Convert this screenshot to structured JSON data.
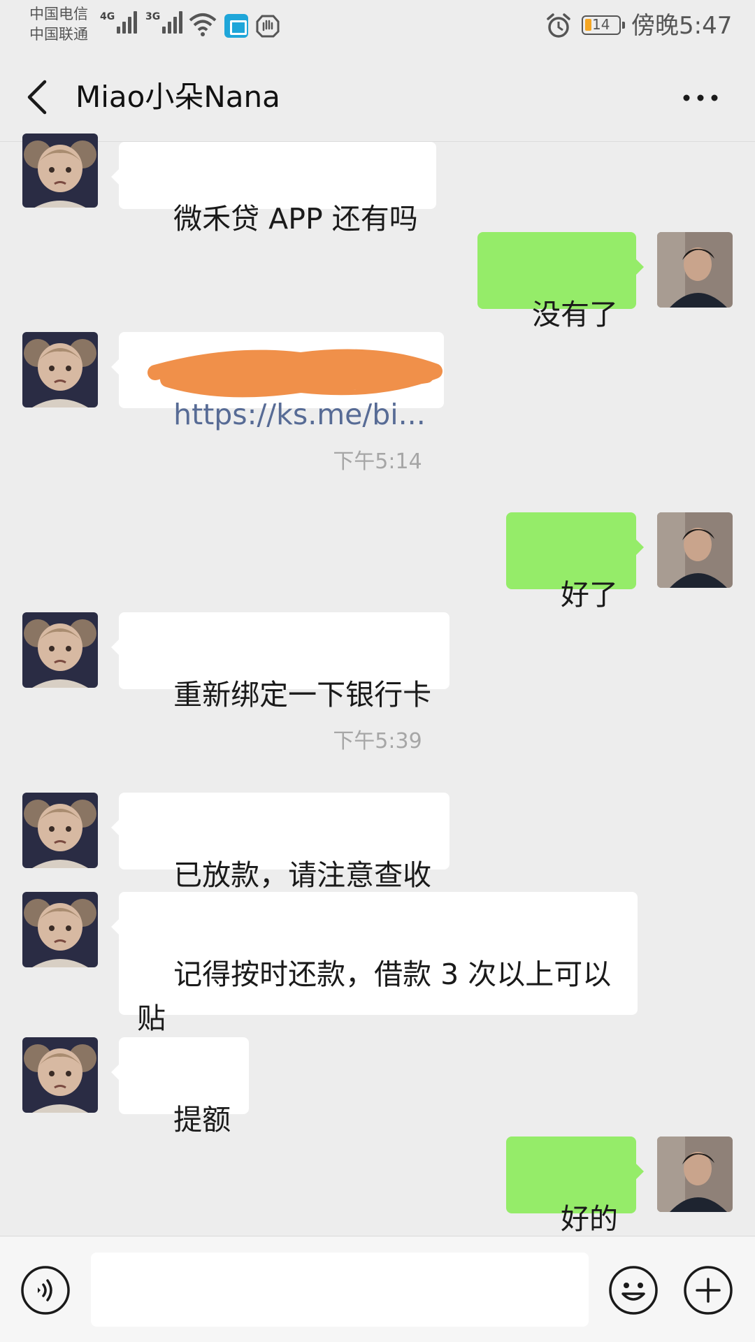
{
  "status_bar": {
    "carrier_1": "中国电信",
    "carrier_2": "中国联通",
    "network_1": "4G",
    "network_2": "3G",
    "battery_level": "14",
    "time": "傍晚5:47"
  },
  "header": {
    "back_icon": "chevron-left-icon",
    "title": "Miao小朵Nana",
    "more_icon": "more-dots-icon"
  },
  "messages": [
    {
      "side": "left",
      "text": "微禾贷 APP 还有吗"
    },
    {
      "side": "right",
      "text": "没有了"
    },
    {
      "side": "left",
      "text": "https://ks.me/bi...",
      "note": "link (partially obscured)"
    },
    {
      "timestamp": "下午5:14"
    },
    {
      "side": "right",
      "text": "好了"
    },
    {
      "side": "left",
      "text": "重新绑定一下银行卡"
    },
    {
      "timestamp": "下午5:39"
    },
    {
      "side": "left",
      "text": "已放款，请注意查收"
    },
    {
      "side": "left",
      "text": "记得按时还款，借款 3 次以上可以\n贴"
    },
    {
      "side": "left",
      "text": "提额"
    },
    {
      "side": "right",
      "text": "好的"
    }
  ],
  "input_bar": {
    "voice_icon": "voice-icon",
    "input_value": "",
    "emoji_icon": "emoji-icon",
    "plus_icon": "plus-icon"
  },
  "colors": {
    "background": "#ededed",
    "bubble_self": "#95ec69",
    "bubble_other": "#ffffff",
    "link": "#576b95",
    "timestamp": "#a6a6a6"
  }
}
